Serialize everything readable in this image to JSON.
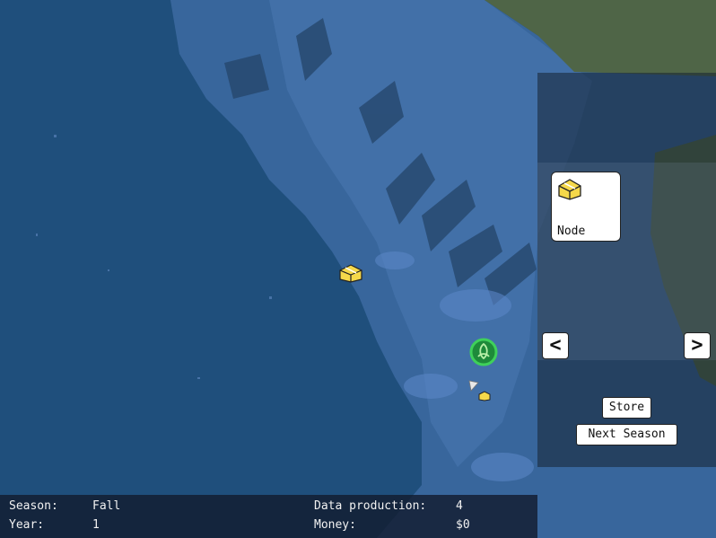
{
  "panel": {
    "selected_card": {
      "label": "Node",
      "icon": "treasure-chest-icon"
    },
    "prev_label": "<",
    "next_label": ">",
    "store_label": "Store",
    "next_season_label": "Next Season"
  },
  "status": {
    "season_label": "Season:",
    "season_value": "Fall",
    "year_label": "Year:",
    "year_value": "1",
    "data_production_label": "Data production:",
    "data_production_value": "4",
    "money_label": "Money:",
    "money_value": "$0"
  },
  "map": {
    "water_color": "#1f4f7c",
    "shallow_color": "#3e6ea5",
    "land_color": "#4f6547"
  }
}
